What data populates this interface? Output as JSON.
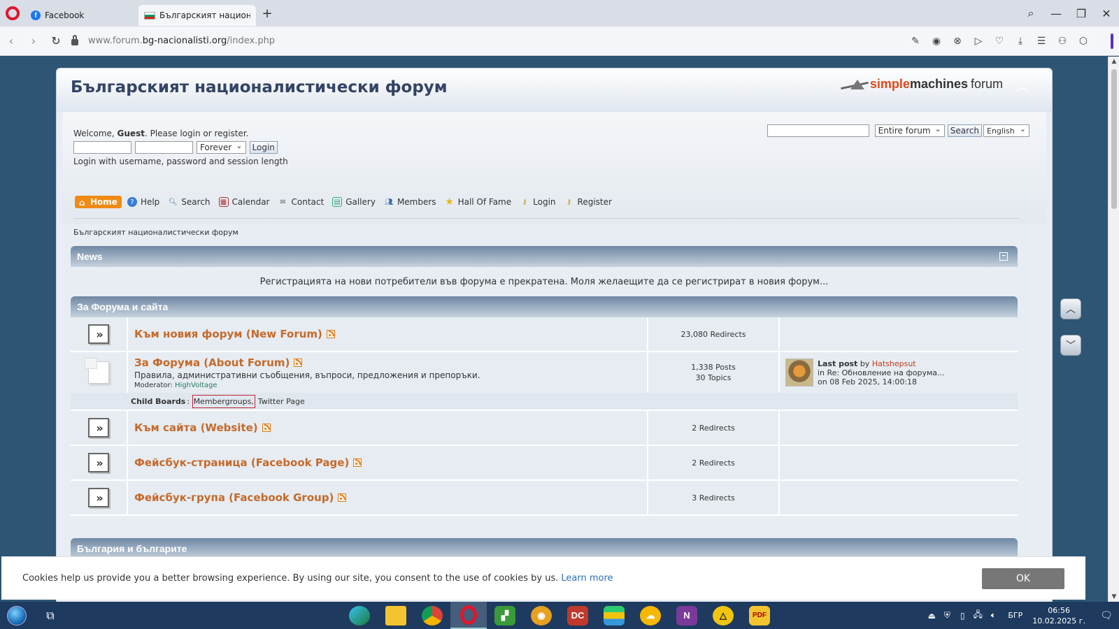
{
  "browser": {
    "tabs": [
      {
        "title": "Facebook",
        "active": false
      },
      {
        "title": "Българският националис",
        "active": true
      }
    ],
    "new_tab": "+",
    "url_prefix": "www.forum.",
    "url_host": "bg-nacionalisti.org",
    "url_path": "/index.php",
    "window_controls": {
      "search": "⌕",
      "minimize": "—",
      "restore": "❐",
      "close": "✕"
    }
  },
  "forum": {
    "title": "Българският националистически форум",
    "logo": {
      "part1": "simple",
      "part2": "machines",
      "part3": "forum"
    },
    "welcome_prefix": "Welcome, ",
    "welcome_user": "Guest",
    "welcome_suffix": ". Please login or register.",
    "login_length": "Forever",
    "login_button": "Login",
    "login_hint": "Login with username, password and session length",
    "search_scope": "Entire forum",
    "search_button": "Search",
    "language": "English",
    "menu": [
      {
        "label": "Home",
        "icon": "home-icon"
      },
      {
        "label": "Help",
        "icon": "help-icon"
      },
      {
        "label": "Search",
        "icon": "search-icon"
      },
      {
        "label": "Calendar",
        "icon": "calendar-icon"
      },
      {
        "label": "Contact",
        "icon": "contact-icon"
      },
      {
        "label": "Gallery",
        "icon": "gallery-icon"
      },
      {
        "label": "Members",
        "icon": "members-icon"
      },
      {
        "label": "Hall Of Fame",
        "icon": "star-icon"
      },
      {
        "label": "Login",
        "icon": "key-icon"
      },
      {
        "label": "Register",
        "icon": "register-icon"
      }
    ],
    "breadcrumb": "Българският националистически форум",
    "news_title": "News",
    "news_text": "Регистрацията на нови потребители във форума е прекратена. Моля желаещите да се регистрират в новия форум...",
    "category1": "За Форума и сайта",
    "boards": [
      {
        "name": "Към новия форум (New Forum)",
        "stats1": "23,080 Redirects",
        "stats2": ""
      },
      {
        "name": "За Форума (About Forum)",
        "desc": "Правила, административни съобщения, въпроси, предложения и препоръки.",
        "moderator_label": "Moderator:",
        "moderator": "HighVoltage",
        "stats1": "1,338 Posts",
        "stats2": "30 Topics",
        "last_post_label": "Last post",
        "last_post_by": "by",
        "last_post_user": "Hatshepsut",
        "last_post_in": "in Re: Обновление на форума...",
        "last_post_on": "on 08 Feb 2025, 14:00:18",
        "child_label": "Child Boards",
        "children": [
          "Membergroups,",
          "Twitter Page"
        ]
      },
      {
        "name": "Към сайта (Website)",
        "stats1": "2 Redirects",
        "stats2": ""
      },
      {
        "name": "Фейсбук-страница (Facebook Page)",
        "stats1": "2 Redirects",
        "stats2": ""
      },
      {
        "name": "Фейсбук-група (Facebook Group)",
        "stats1": "3 Redirects",
        "stats2": ""
      }
    ],
    "category2": "България и българите"
  },
  "cookie": {
    "text": "Cookies help us provide you a better browsing experience. By using our site, you consent to the use of cookies by us.",
    "learn_more": "Learn more",
    "ok": "OK"
  },
  "taskbar": {
    "lang": "БГР",
    "time": "06:56",
    "date": "10.02.2025 г."
  }
}
